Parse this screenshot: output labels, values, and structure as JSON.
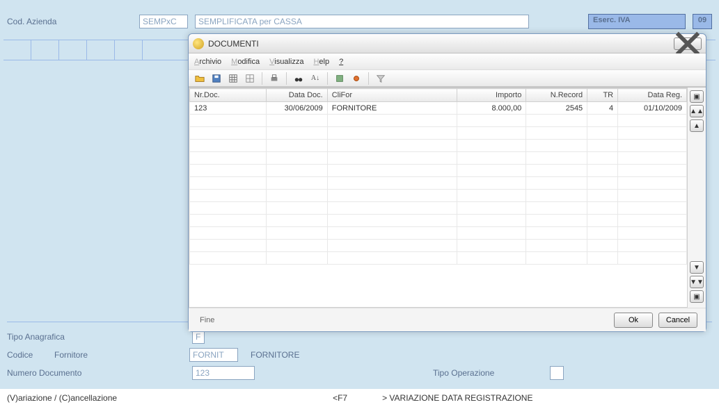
{
  "backForm": {
    "codAziendaLabel": "Cod. Azienda",
    "codAziendaValue": "SEMPxC",
    "codAziendaDesc": "SEMPLIFICATA per CASSA",
    "esercIvaLabel": "Eserc. IVA",
    "esercIvaValue": "09",
    "tipoAnagraficaLabel": "Tipo Anagrafica",
    "tipoAnagraficaValue": "F",
    "codiceLabel": "Codice",
    "fornitoreLabel": "Fornitore",
    "codiceValue": "FORNIT",
    "fornitoreDesc": "FORNITORE",
    "numeroDocLabel": "Numero Documento",
    "numeroDocValue": "123",
    "tipoOperazioneLabel": "Tipo Operazione",
    "tipoOperazioneValue": ""
  },
  "statusBar": {
    "left": "(V)ariazione / (C)ancellazione",
    "mid": "<F7",
    "right": "> VARIAZIONE DATA REGISTRAZIONE"
  },
  "dialog": {
    "title": "DOCUMENTI",
    "menu": {
      "archivio": "Archivio",
      "modifica": "Modifica",
      "visualizza": "Visualizza",
      "help": "Help",
      "q": "?"
    },
    "columns": [
      "Nr.Doc.",
      "Data Doc.",
      "CliFor",
      "Importo",
      "N.Record",
      "TR",
      "Data Reg."
    ],
    "rows": [
      {
        "nrDoc": "123",
        "dataDoc": "30/06/2009",
        "cliFor": "FORNITORE",
        "importo": "8.000,00",
        "nRecord": "2545",
        "tr": "4",
        "dataReg": "01/10/2009"
      }
    ],
    "footerStatus": "Fine",
    "okLabel": "Ok",
    "cancelLabel": "Cancel"
  }
}
